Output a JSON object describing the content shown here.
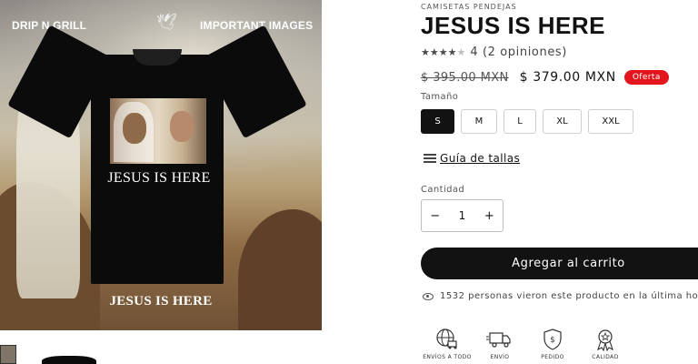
{
  "media": {
    "caption_left": "DRIP N GRILL",
    "caption_right": "IMPORTANT IMAGES",
    "shirt_text": "JESUS IS HERE",
    "bottom_text": "JESUS IS HERE"
  },
  "product": {
    "vendor": "CAMISETAS PENDEJAS",
    "title": "JESUS IS HERE",
    "rating_value": 4,
    "rating_max": 5,
    "rating_text": "4 (2 opiniones)",
    "price_old": "$ 395.00 MXN",
    "price_new": "$ 379.00 MXN",
    "sale_badge": "Oferta",
    "size_label": "Tamaño",
    "sizes": [
      "S",
      "M",
      "L",
      "XL",
      "XXL"
    ],
    "selected_size": "S",
    "size_guide": "Guía de tallas",
    "quantity_label": "Cantidad",
    "quantity_minus": "−",
    "quantity_value": "1",
    "quantity_plus": "+",
    "add_to_cart": "Agregar al carrito",
    "viewers_text": "1532 personas vieron este producto en la última ho"
  },
  "features": [
    {
      "label": "ENVÍOS A TODO",
      "icon": "globe-truck-icon"
    },
    {
      "label": "ENVÍO",
      "icon": "delivery-truck-icon"
    },
    {
      "label": "PEDIDO",
      "icon": "shield-check-icon"
    },
    {
      "label": "CALIDAD",
      "icon": "award-ribbon-icon"
    }
  ],
  "colors": {
    "primary": "#121212",
    "sale_badge": "#e3161e",
    "border": "#cfcfcf"
  }
}
